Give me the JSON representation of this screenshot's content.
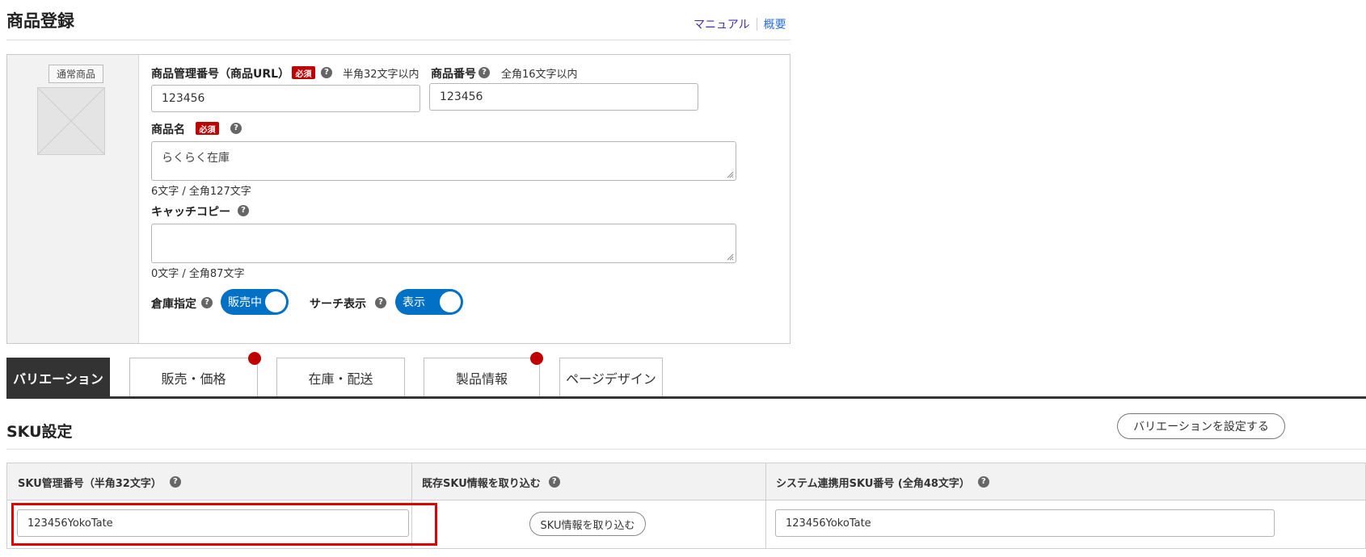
{
  "header": {
    "title": "商品登録",
    "manual_link": "マニュアル",
    "overview_link": "概要"
  },
  "product": {
    "image_badge": "通常商品",
    "management_number": {
      "label": "商品管理番号（商品URL）",
      "required": "必須",
      "hint": "半角32文字以内",
      "value": "123456"
    },
    "product_number": {
      "label": "商品番号",
      "hint": "全角16文字以内",
      "value": "123456"
    },
    "product_name": {
      "label": "商品名",
      "required": "必須",
      "value": "らくらく在庫",
      "count": "6文字 / 全角127文字"
    },
    "catch_copy": {
      "label": "キャッチコピー",
      "value": "",
      "count": "0文字 / 全角87文字"
    },
    "warehouse": {
      "label": "倉庫指定",
      "toggle_label": "販売中",
      "on": true
    },
    "search_display": {
      "label": "サーチ表示",
      "toggle_label": "表示",
      "on": true
    }
  },
  "tabs": [
    {
      "label": "バリエーション",
      "active": true,
      "alert": false
    },
    {
      "label": "販売・価格",
      "active": false,
      "alert": true
    },
    {
      "label": "在庫・配送",
      "active": false,
      "alert": false
    },
    {
      "label": "製品情報",
      "active": false,
      "alert": true
    },
    {
      "label": "ページデザイン",
      "active": false,
      "alert": false
    }
  ],
  "sku": {
    "title": "SKU設定",
    "set_variation_button": "バリエーションを設定する",
    "columns": [
      "SKU管理番号（半角32文字）",
      "既存SKU情報を取り込む",
      "システム連携用SKU番号 (全角48文字）"
    ],
    "row": {
      "sku_number": "123456YokoTate",
      "import_button": "SKU情報を取り込む",
      "system_sku": "123456YokoTate"
    }
  },
  "colors": {
    "accent_blue": "#0071c5",
    "required_red": "#bf0000",
    "highlight_red": "#e00000",
    "tab_active": "#333333"
  }
}
